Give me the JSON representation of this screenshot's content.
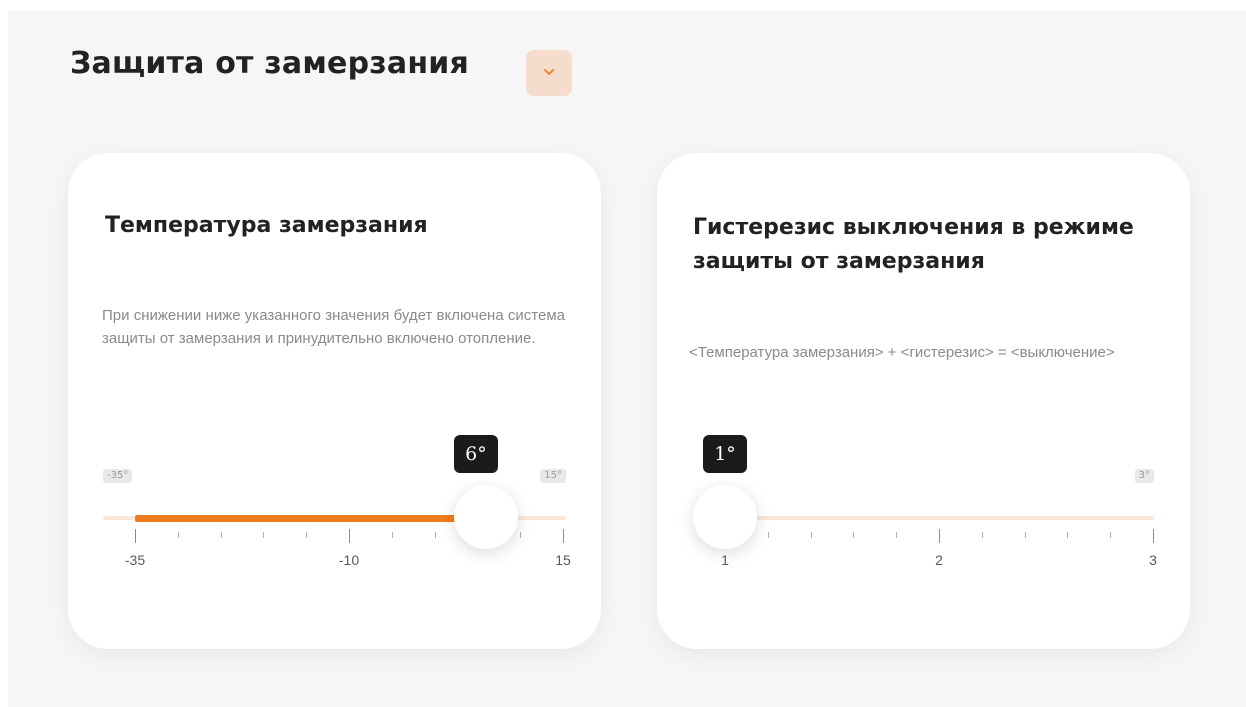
{
  "section": {
    "title": "Защита от замерзания",
    "toggle_icon": "chevron-down-icon",
    "accent_color": "#ef7d1c"
  },
  "cards": [
    {
      "title": "Температура замерзания",
      "description": "При снижении ниже указанного значения будет включена система защиты от замерзания и принудительно включено отопление.",
      "slider": {
        "min": -35,
        "max": 15,
        "value": 6,
        "value_label": "6°",
        "min_badge": "-35°",
        "max_badge": "15°",
        "tick_labels": [
          "-35",
          "-10",
          "15"
        ],
        "major_ticks": [
          -35,
          -10,
          15
        ],
        "minor_ticks": [
          -30,
          -25,
          -20,
          -15,
          -5,
          0,
          5,
          10
        ],
        "filled": true
      }
    },
    {
      "title": "Гистерезис выключения в режиме защиты от замерзания",
      "description": "<Температура замерзания> + <гистерезис> = <выключение>",
      "slider": {
        "min": 1,
        "max": 3,
        "value": 1,
        "value_label": "1°",
        "min_badge": "",
        "max_badge": "3°",
        "tick_labels": [
          "1",
          "2",
          "3"
        ],
        "major_ticks": [
          1,
          2,
          3
        ],
        "minor_ticks": [
          1.2,
          1.4,
          1.6,
          1.8,
          2.2,
          2.4,
          2.6,
          2.8
        ],
        "filled": false
      }
    }
  ]
}
